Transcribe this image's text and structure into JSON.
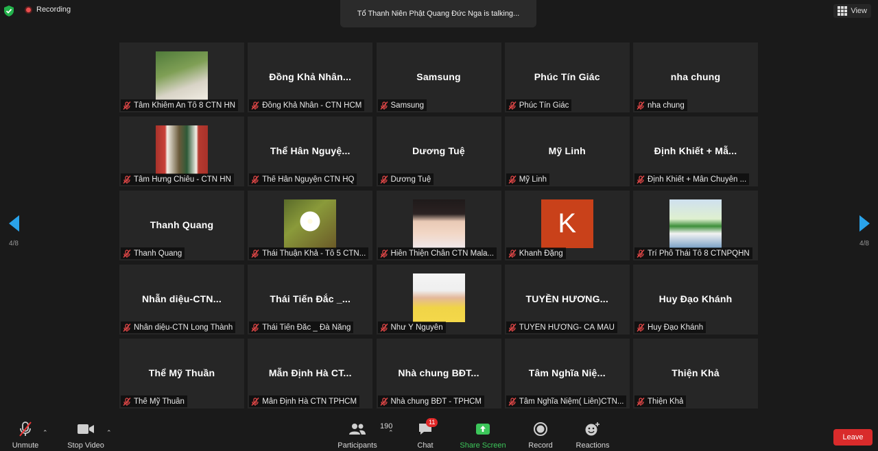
{
  "top": {
    "recording_label": "Recording",
    "talking_text": "Tổ Thanh Niên Phật Quang Đức Nga is talking...",
    "view_label": "View"
  },
  "nav": {
    "left_page": "4/8",
    "right_page": "4/8",
    "accent": "#2aa3ea"
  },
  "tiles": [
    {
      "center": "",
      "label": "Tâm Khiêm An Tổ 8 CTN HN",
      "avatar": "green"
    },
    {
      "center": "Đồng Khả Nhân...",
      "label": "Đồng Khả Nhân - CTN HCM",
      "avatar": ""
    },
    {
      "center": "Samsung",
      "label": "Samsung",
      "avatar": ""
    },
    {
      "center": "Phúc Tín Giác",
      "label": "Phúc Tín Giác",
      "avatar": ""
    },
    {
      "center": "nha chung",
      "label": "nha chung",
      "avatar": ""
    },
    {
      "center": "",
      "label": "Tâm Hưng Chiêu - CTN HN",
      "avatar": "door"
    },
    {
      "center": "Thể Hân Nguyệ...",
      "label": "Thể Hân Nguyện CTN HQ",
      "avatar": ""
    },
    {
      "center": "Dương Tuệ",
      "label": "Dương Tuệ",
      "avatar": ""
    },
    {
      "center": "Mỹ Linh",
      "label": "Mỹ Linh",
      "avatar": ""
    },
    {
      "center": "Định Khiết + Mẫ...",
      "label": "Định Khiết + Mẫn Chuyên ...",
      "avatar": ""
    },
    {
      "center": "Thanh Quang",
      "label": "Thanh Quang",
      "avatar": ""
    },
    {
      "center": "",
      "label": "Thái Thuận Khả - Tổ 5 CTN...",
      "avatar": "flower"
    },
    {
      "center": "",
      "label": "Hiền Thiện Chân CTN Mala...",
      "avatar": "girl"
    },
    {
      "center": "",
      "label": "Khanh Đặng",
      "avatar": "k",
      "avatar_letter": "K"
    },
    {
      "center": "",
      "label": "Trí Phổ Thái Tổ 8 CTNPQHN",
      "avatar": "banner"
    },
    {
      "center": "Nhẫn diệu-CTN...",
      "label": "Nhẫn diệu-CTN Long Thành",
      "avatar": ""
    },
    {
      "center": "Thái Tiến Đắc _...",
      "label": "Thái Tiến Đắc _ Đà Nẵng",
      "avatar": ""
    },
    {
      "center": "",
      "label": "Như Ý Nguyễn",
      "avatar": "yellow"
    },
    {
      "center": "TUYỀN HƯƠNG...",
      "label": "TUYỀN HƯƠNG- CÀ MAU",
      "avatar": ""
    },
    {
      "center": "Huy Đạo Khánh",
      "label": "Huy Đạo Khánh",
      "avatar": ""
    },
    {
      "center": "Thể Mỹ Thuần",
      "label": "Thể Mỹ Thuần",
      "avatar": ""
    },
    {
      "center": "Mẫn Định Hà CT...",
      "label": "Mẫn Định Hà CTN TPHCM",
      "avatar": ""
    },
    {
      "center": "Nhà chung BĐT...",
      "label": "Nhà chung BĐT - TPHCM",
      "avatar": ""
    },
    {
      "center": "Tâm Nghĩa Niệ...",
      "label": "Tâm Nghĩa Niệm( Liên)CTN...",
      "avatar": ""
    },
    {
      "center": "Thiện Khả",
      "label": "Thiện Khả",
      "avatar": ""
    }
  ],
  "toolbar": {
    "unmute": "Unmute",
    "stop_video": "Stop Video",
    "participants": "Participants",
    "participant_count": "190",
    "chat": "Chat",
    "chat_badge": "11",
    "share_screen": "Share Screen",
    "record": "Record",
    "reactions": "Reactions",
    "leave": "Leave",
    "leave_color": "#d92b2b",
    "share_color": "#3cc65a"
  }
}
